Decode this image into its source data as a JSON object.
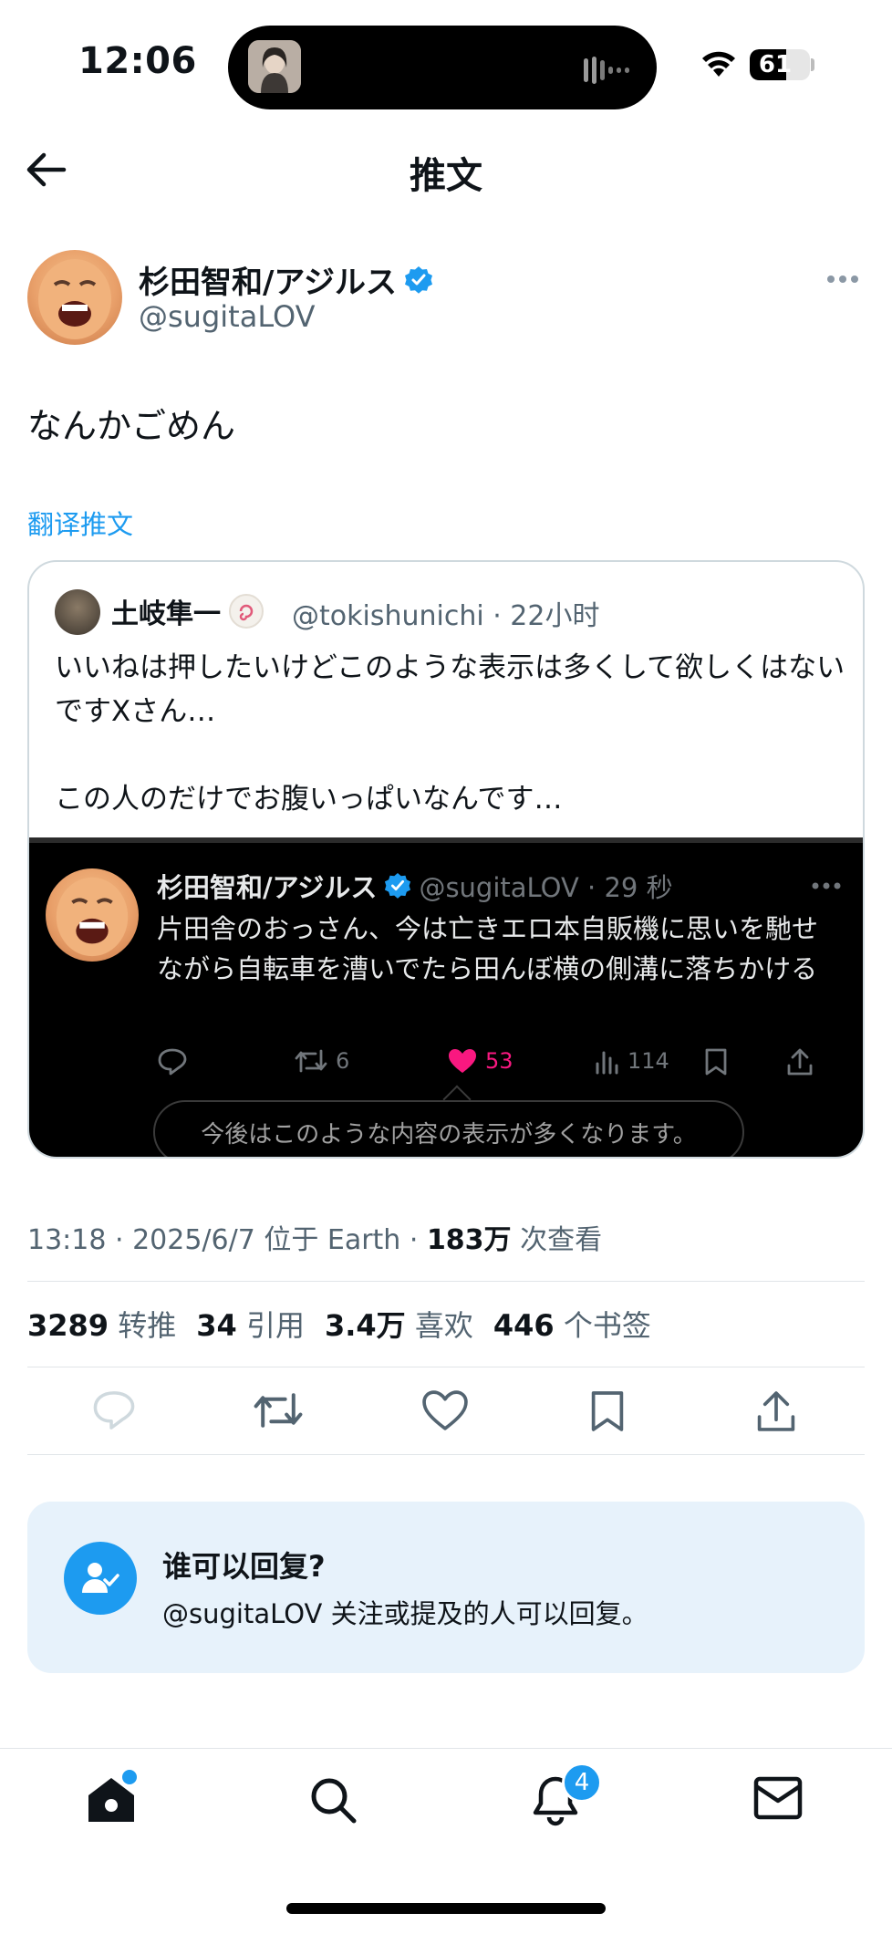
{
  "status_bar": {
    "time": "12:06",
    "battery": "61",
    "battery_level_pct": 61
  },
  "header": {
    "title": "推文"
  },
  "tweet": {
    "author": {
      "name": "杉田智和/アジルス",
      "handle": "@sugitaLOV",
      "verified": true
    },
    "text": "なんかごめん",
    "translate_label": "翻译推文",
    "meta": {
      "time_date_location": "13:18 · 2025/6/7 位于 Earth · ",
      "views_count": "183万",
      "views_label": " 次查看"
    },
    "stats": [
      {
        "count": "3289",
        "label": "转推"
      },
      {
        "count": "34",
        "label": "引用"
      },
      {
        "count": "3.4万",
        "label": "喜欢"
      },
      {
        "count": "446",
        "label": "个书签"
      }
    ],
    "actions": [
      "reply-icon",
      "retweet-icon",
      "like-icon",
      "bookmark-icon",
      "share-icon"
    ]
  },
  "quote": {
    "author": {
      "name": "土岐隼一",
      "handle_time": "@tokishunichi · 22小时"
    },
    "text": "いいねは押したいけどこのような表示は多くして欲しくはないですXさん…\n\nこの人のだけでお腹いっぱいなんです…",
    "screenshot": {
      "name": "杉田智和/アジルス",
      "handle_time": "@sugitaLOV · 29 秒",
      "text": "片田舎のおっさん、今は亡きエロ本自販機に思いを馳せながら自転車を漕いでたら田んぼ横の側溝に落ちかける",
      "retweets": "6",
      "likes": "53",
      "views": "114",
      "tooltip": "今後はこのような内容の表示が多くなります。",
      "like_color": "#f91880"
    }
  },
  "reply_settings": {
    "title": "谁可以回复?",
    "description": "@sugitaLOV 关注或提及的人可以回复。"
  },
  "tab_bar": {
    "items": [
      "home-icon",
      "search-icon",
      "notifications-icon",
      "messages-icon"
    ],
    "notification_badge": "4"
  },
  "colors": {
    "accent": "#1d9bf0",
    "secondary_text": "#536471",
    "reply_box_bg": "#e7f2fb"
  }
}
